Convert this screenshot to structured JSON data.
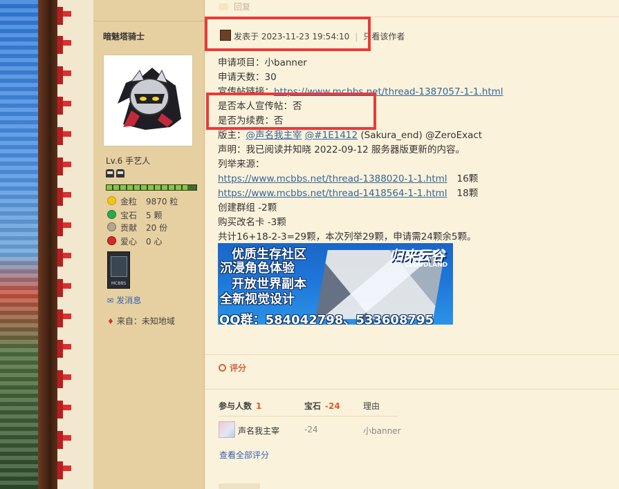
{
  "reply": {
    "label": "回复"
  },
  "author": {
    "name": "暗魅塔骑士",
    "level": "Lv.6 手艺人",
    "level_progress_percent": 90,
    "stats": [
      {
        "label": "金粒",
        "value": "9870 粒",
        "icon": "gold-nugget-icon",
        "color": "#f0c419"
      },
      {
        "label": "宝石",
        "value": "5 颗",
        "icon": "gem-icon",
        "color": "#2ea84a"
      },
      {
        "label": "贡献",
        "value": "20 份",
        "icon": "contribution-icon",
        "color": "#9a8a7a"
      },
      {
        "label": "爱心",
        "value": "0 心",
        "icon": "apple-heart-icon",
        "color": "#d42a2a"
      }
    ],
    "badge": "MCBBS",
    "send_message": "发消息",
    "location": "来自：未知地域"
  },
  "post": {
    "posted_at": "发表于 2023-11-23 19:54:10",
    "only_author": "只看该作者",
    "lines": {
      "apply_item": "申请项目：小banner",
      "apply_days": "申请天数：30",
      "promo_label": "宣传帖链接：",
      "promo_link": "https://www.mcbbs.net/thread-1387057-1-1.html",
      "is_own": "是否本人宣传帖：否",
      "is_renew": "是否为续费：否",
      "mod_label": "版主：",
      "mod_1": "@声名我主宰",
      "mod_2": "@#1E1412",
      "mod_rest": "(Sakura_end) @ZeroExact",
      "declare": "声明：我已阅读并知晓 2022-09-12 服务器版更新的内容。",
      "source_label": "列举来源：",
      "source_1_link": "https://www.mcbbs.net/thread-1388020-1-1.html",
      "source_1_val": "16颗",
      "source_2_link": "https://www.mcbbs.net/thread-1418564-1-1.html",
      "source_2_val": "18颗",
      "create_group": "创建群组 -2颗",
      "rename_card": "购买改名卡 -3颗",
      "total": "共计16+18-2-3=29颗，本次列举29颗，申请需24颗余5颗。"
    },
    "banner": {
      "line1": "优质生存社区",
      "line2": "沉浸角色体验",
      "line3": "开放世界副本",
      "line4": "全新视觉设计",
      "qq": "QQ群：584042798、533608795",
      "logo": "归来云谷",
      "logo_sub": "CLOUDLAND"
    }
  },
  "rating": {
    "title": "评分",
    "col_participants": "参与人数",
    "participants": "1",
    "col_gems": "宝石",
    "gems_total": "-24",
    "col_reason": "理由",
    "rows": [
      {
        "user": "声名我主宰",
        "gems": "-24",
        "reason": "小banner"
      }
    ],
    "view_all": "查看全部评分"
  }
}
